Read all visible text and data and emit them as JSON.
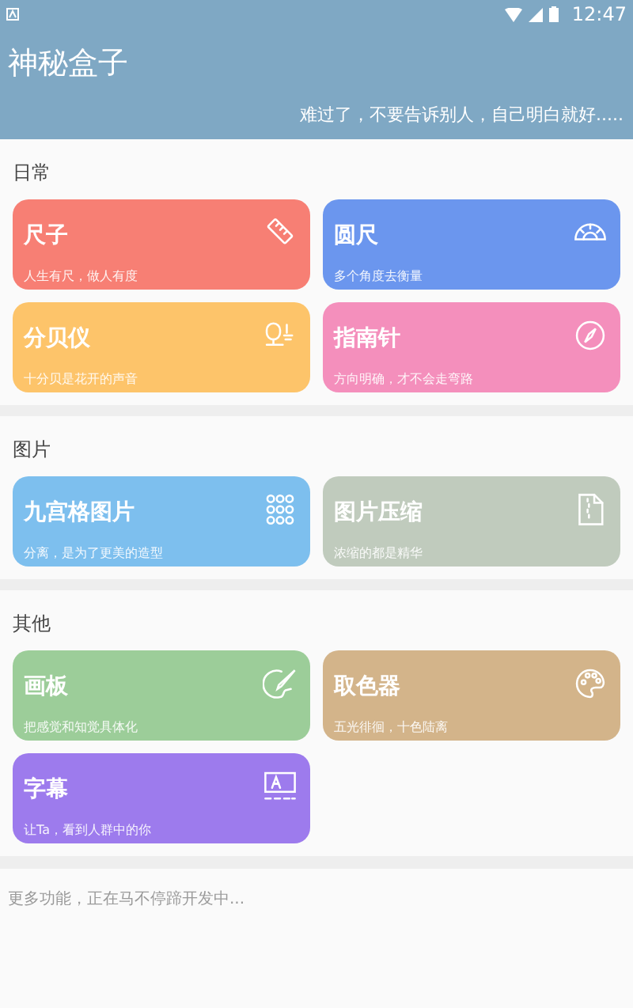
{
  "status_bar": {
    "time": "12:47"
  },
  "header": {
    "title": "神秘盒子",
    "subtitle": "难过了，不要告诉别人，自己明白就好....."
  },
  "sections": [
    {
      "title": "日常",
      "cards": [
        {
          "title": "尺子",
          "subtitle": "人生有尺，做人有度",
          "color": "#f77f74"
        },
        {
          "title": "圆尺",
          "subtitle": "多个角度去衡量",
          "color": "#6b96ee"
        },
        {
          "title": "分贝仪",
          "subtitle": "十分贝是花开的声音",
          "color": "#fdc46a"
        },
        {
          "title": "指南针",
          "subtitle": "方向明确，才不会走弯路",
          "color": "#f48fbc"
        }
      ]
    },
    {
      "title": "图片",
      "cards": [
        {
          "title": "九宫格图片",
          "subtitle": "分离，是为了更美的造型",
          "color": "#7dbfee"
        },
        {
          "title": "图片压缩",
          "subtitle": "浓缩的都是精华",
          "color": "#c0cbbd"
        }
      ]
    },
    {
      "title": "其他",
      "cards": [
        {
          "title": "画板",
          "subtitle": "把感觉和知觉具体化",
          "color": "#9ccd99"
        },
        {
          "title": "取色器",
          "subtitle": "五光徘徊，十色陆离",
          "color": "#d3b48a"
        },
        {
          "title": "字幕",
          "subtitle": "让Ta，看到人群中的你",
          "color": "#9d7bed"
        }
      ]
    }
  ],
  "footer": "更多功能，正在马不停蹄开发中..."
}
